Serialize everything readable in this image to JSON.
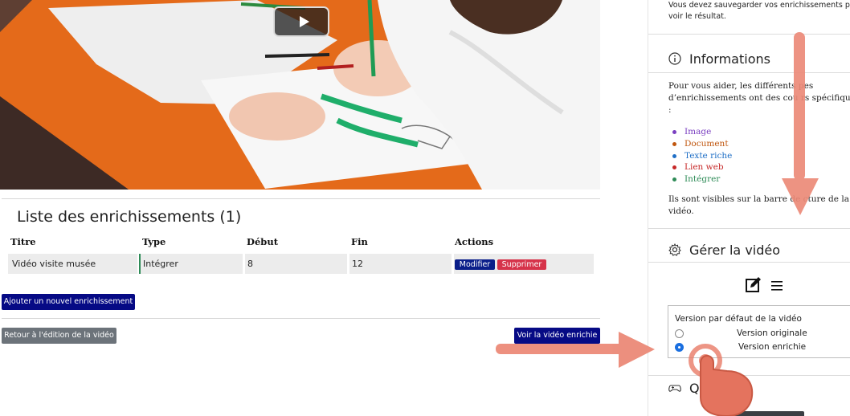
{
  "video": {
    "play_label": "Lecture"
  },
  "list": {
    "title": "Liste des enrichissements (1)",
    "columns": [
      "Titre",
      "Type",
      "Début",
      "Fin",
      "Actions"
    ],
    "rows": [
      {
        "titre": "Vidéo visite musée",
        "type": "Intégrer",
        "debut": "8",
        "fin": "12"
      }
    ],
    "modify_label": "Modifier",
    "delete_label": "Supprimer"
  },
  "buttons": {
    "add": "Ajouter un nouvel enrichissement",
    "back": "Retour à l'édition de la vidéo",
    "view": "Voir la vidéo enrichie"
  },
  "sidebar": {
    "notice": "Vous devez sauvegarder vos enrichissements pou voir le résultat.",
    "info_title": "Informations",
    "info_text": "Pour vous aider, les différents  pes d’enrichissements ont des cou  rs spécifiques :",
    "legend": [
      {
        "label": "Image",
        "color": "#7a3fc0"
      },
      {
        "label": "Document",
        "color": "#c0560e"
      },
      {
        "label": "Texte riche",
        "color": "#1f6fc6"
      },
      {
        "label": "Lien web",
        "color": "#c62828"
      },
      {
        "label": "Intégrer",
        "color": "#2e8b57"
      }
    ],
    "visible_text": "Ils sont visibles sur la barre de  cture de la vidéo.",
    "manage_title": "Gérer la vidéo",
    "version_label": "Version par défaut de la vidéo",
    "option_original": "Version originale",
    "option_enriched": "Version enrichie",
    "quiz_title": "Qu"
  },
  "colors": {
    "primary": "#060a85",
    "danger": "#d6334a",
    "secondary": "#6c737a",
    "annotation": "#ec8a78"
  }
}
